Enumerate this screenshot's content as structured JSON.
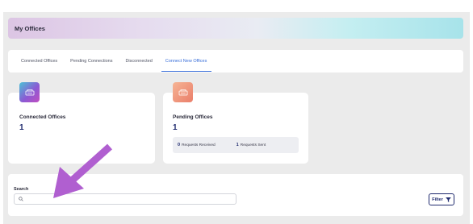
{
  "header": {
    "title": "My Offices"
  },
  "tabs": [
    {
      "label": "Connected Offices"
    },
    {
      "label": "Pending Connections"
    },
    {
      "label": "Disconnected"
    },
    {
      "label": "Connect New Offices",
      "active": true
    }
  ],
  "cards": {
    "connected": {
      "label": "Connected Offices",
      "value": "1",
      "icon": "office-building-icon"
    },
    "pending": {
      "label": "Pending Offices",
      "value": "1",
      "icon": "office-building-icon",
      "requests_received": {
        "count": "0",
        "label": "Requests Received"
      },
      "requests_sent": {
        "count": "1",
        "label": "Requests Sent"
      }
    }
  },
  "search": {
    "label": "Search",
    "value": "",
    "placeholder": ""
  },
  "filter": {
    "label": "Filter",
    "icon": "funnel-icon"
  },
  "colors": {
    "accent": "#3a6fd9",
    "navy": "#1f2a6e",
    "arrow": "#b05fd0"
  },
  "annotation": {
    "icon": "pointer-arrow"
  }
}
